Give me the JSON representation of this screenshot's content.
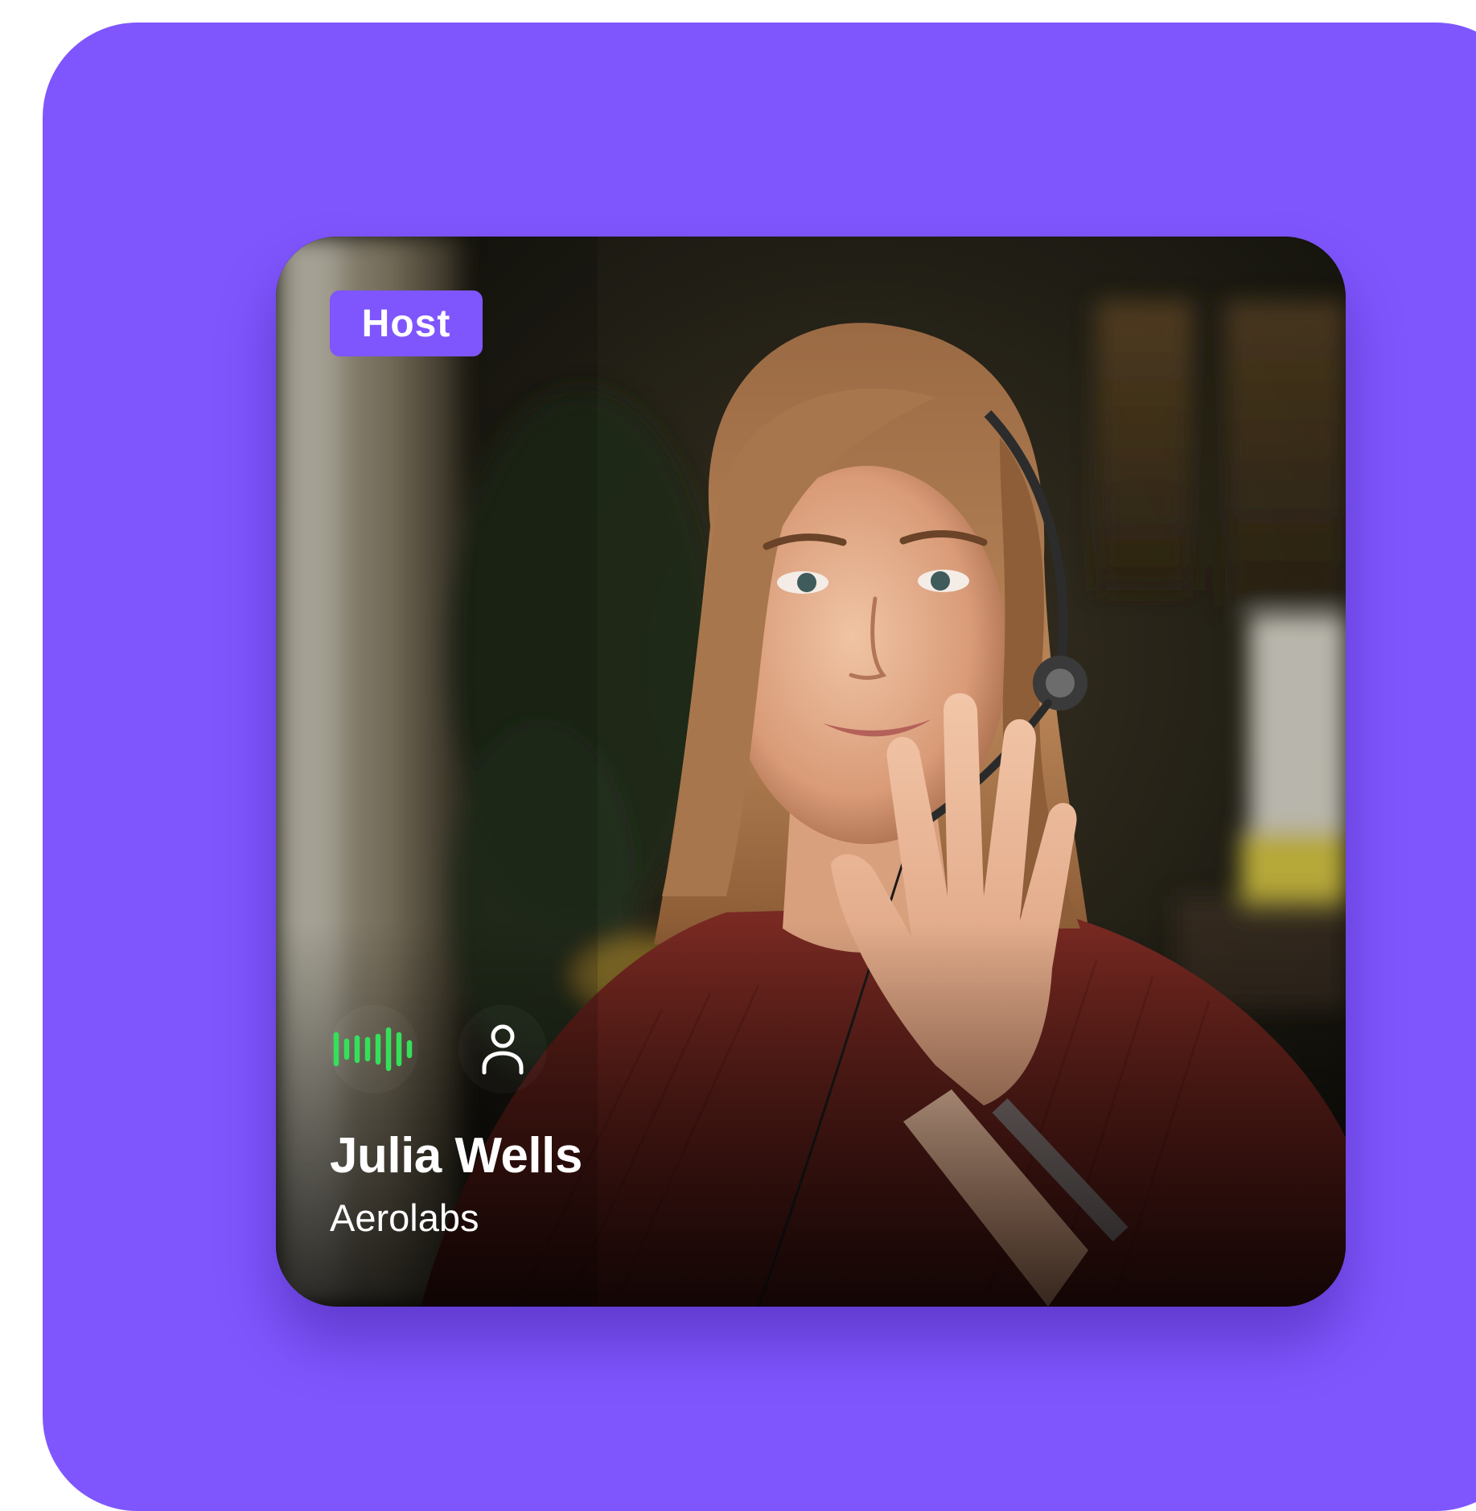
{
  "participant": {
    "role_badge": "Host",
    "name": "Julia Wells",
    "organization": "Aerolabs"
  },
  "controls": {
    "audio_icon": "audio-waveform-icon",
    "profile_icon": "user-profile-icon"
  },
  "colors": {
    "background": "#7f56fd",
    "badge": "#7f56fd",
    "audio_active": "#35e05a",
    "text": "#ffffff"
  }
}
